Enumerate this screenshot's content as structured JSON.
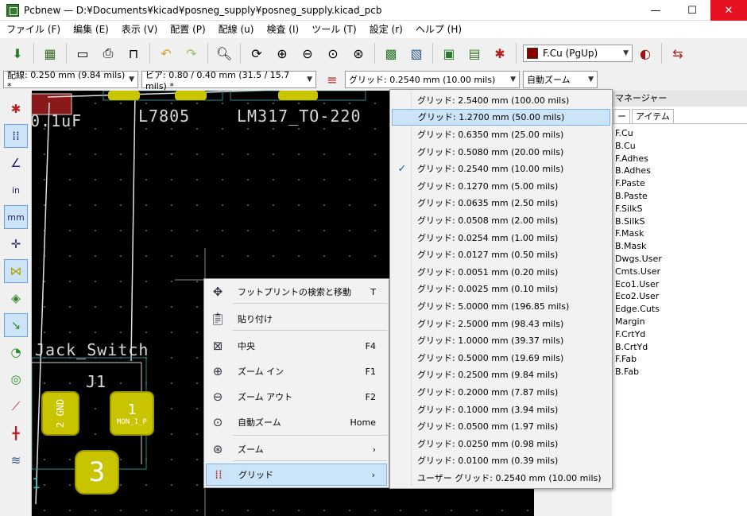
{
  "window": {
    "title": "Pcbnew — D:¥Documents¥kicad¥posneg_supply¥posneg_supply.kicad_pcb"
  },
  "menubar": [
    "ファイル (F)",
    "編集 (E)",
    "表示 (V)",
    "配置 (P)",
    "配線 (u)",
    "検査 (I)",
    "ツール (T)",
    "設定 (r)",
    "ヘルプ (H)"
  ],
  "toolbar": {
    "layer_select": "F.Cu (PgUp)",
    "layer_color": "#8a0000"
  },
  "toolbar2": {
    "track_width": "配線: 0.250 mm (9.84 mils) *",
    "via_size": "ビア: 0.80 / 0.40 mm (31.5 / 15.7 mils) *",
    "grid": "グリッド: 0.2540 mm (10.00 mils)",
    "zoom": "自動ズーム"
  },
  "canvas": {
    "labels": [
      "0.1uF",
      "L7805",
      "LM317_TO-220",
      "Jack_Switch",
      "J1"
    ],
    "pads": [
      "2 GND",
      "1",
      "MON_I_P",
      "3",
      "1"
    ]
  },
  "right_panel": {
    "title": "マネージャー",
    "tabs": [
      "ー",
      "アイテム"
    ],
    "layers": [
      "F.Cu",
      "B.Cu",
      "F.Adhes",
      "B.Adhes",
      "F.Paste",
      "B.Paste",
      "F.SilkS",
      "B.SilkS",
      "F.Mask",
      "B.Mask",
      "Dwgs.User",
      "Cmts.User",
      "Eco1.User",
      "Eco2.User",
      "Edge.Cuts",
      "Margin",
      "F.CrtYd",
      "B.CrtYd",
      "F.Fab",
      "B.Fab"
    ]
  },
  "context_menu": {
    "items": [
      {
        "label": "フットプリントの検索と移動",
        "shortcut": "T",
        "icon": "move-icon"
      },
      {
        "label": "貼り付け",
        "shortcut": "",
        "icon": "paste-icon"
      },
      {
        "label": "中央",
        "shortcut": "F4",
        "icon": "zoom-center-icon"
      },
      {
        "label": "ズーム イン",
        "shortcut": "F1",
        "icon": "zoom-in-icon"
      },
      {
        "label": "ズーム アウト",
        "shortcut": "F2",
        "icon": "zoom-out-icon"
      },
      {
        "label": "自動ズーム",
        "shortcut": "Home",
        "icon": "zoom-fit-icon"
      },
      {
        "label": "ズーム",
        "shortcut": "›",
        "icon": "zoom-selection-icon"
      },
      {
        "label": "グリッド",
        "shortcut": "›",
        "icon": "grid-icon"
      }
    ]
  },
  "grid_submenu": {
    "checked_index": 4,
    "highlighted_index": 1,
    "items": [
      "グリッド: 2.5400 mm (100.00 mils)",
      "グリッド: 1.2700 mm (50.00 mils)",
      "グリッド: 0.6350 mm (25.00 mils)",
      "グリッド: 0.5080 mm (20.00 mils)",
      "グリッド: 0.2540 mm (10.00 mils)",
      "グリッド: 0.1270 mm (5.00 mils)",
      "グリッド: 0.0635 mm (2.50 mils)",
      "グリッド: 0.0508 mm (2.00 mils)",
      "グリッド: 0.0254 mm (1.00 mils)",
      "グリッド: 0.0127 mm (0.50 mils)",
      "グリッド: 0.0051 mm (0.20 mils)",
      "グリッド: 0.0025 mm (0.10 mils)",
      "グリッド: 5.0000 mm (196.85 mils)",
      "グリッド: 2.5000 mm (98.43 mils)",
      "グリッド: 1.0000 mm (39.37 mils)",
      "グリッド: 0.5000 mm (19.69 mils)",
      "グリッド: 0.2500 mm (9.84 mils)",
      "グリッド: 0.2000 mm (7.87 mils)",
      "グリッド: 0.1000 mm (3.94 mils)",
      "グリッド: 0.0500 mm (1.97 mils)",
      "グリッド: 0.0250 mm (0.98 mils)",
      "グリッド: 0.0100 mm (0.39 mils)",
      "ユーザー グリッド: 0.2540 mm (10.00 mils)"
    ],
    "check_mark": "✓"
  }
}
